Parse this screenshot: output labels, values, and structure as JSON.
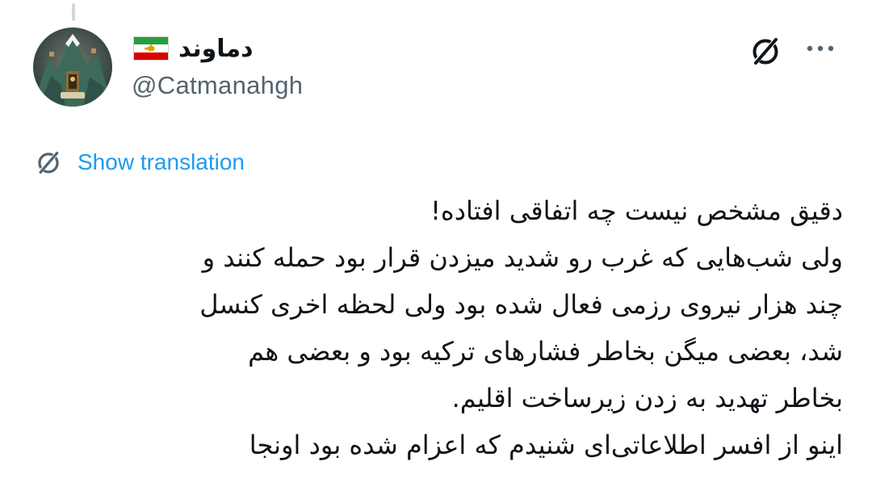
{
  "author": {
    "display_name": "دماوند",
    "handle": "@Catmanahgh",
    "flag_colors": {
      "green": "#239f40",
      "white": "#ffffff",
      "red": "#da0000",
      "emblem": "#e0a000"
    }
  },
  "header": {
    "grok_icon": "grok-slash-circle-icon",
    "more_icon": "more-dots-icon"
  },
  "translation": {
    "label": "Show translation",
    "icon": "grok-slash-circle-icon"
  },
  "tweet": {
    "lines": [
      "دقیق مشخص نیست چه اتفاقی افتاده!",
      "ولی شب‌هایی که غرب رو شدید میزدن قرار بود حمله کنند و",
      "چند هزار نیروی رزمی فعال شده بود ولی لحظه اخری کنسل",
      "شد، بعضی میگن بخاطر فشارهای ترکیه بود و بعضی هم",
      "بخاطر تهدید به زدن زیرساخت اقلیم.",
      "اینو از افسر اطلاعاتی‌ای شنیدم که اعزام شده بود اونجا"
    ]
  },
  "colors": {
    "accent": "#1d9bf0",
    "secondary_text": "#536471",
    "icon_dark": "#0f1419",
    "icon_grey": "#536471"
  }
}
